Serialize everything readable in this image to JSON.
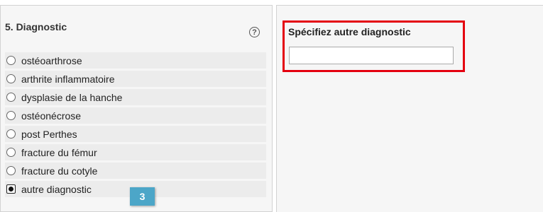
{
  "section": {
    "title": "5. Diagnostic",
    "help_icon": "?"
  },
  "options": [
    {
      "label": "ostéoarthrose",
      "selected": false
    },
    {
      "label": "arthrite inflammatoire",
      "selected": false
    },
    {
      "label": "dysplasie de la hanche",
      "selected": false
    },
    {
      "label": "ostéonécrose",
      "selected": false
    },
    {
      "label": "post Perthes",
      "selected": false
    },
    {
      "label": "fracture du fémur",
      "selected": false
    },
    {
      "label": "fracture du cotyle",
      "selected": false
    },
    {
      "label": "autre diagnostic",
      "selected": true
    }
  ],
  "step_badge": "3",
  "other_field": {
    "label": "Spécifiez autre diagnostic",
    "value": ""
  },
  "colors": {
    "highlight": "#e4000f",
    "badge": "#4ca6c8"
  }
}
